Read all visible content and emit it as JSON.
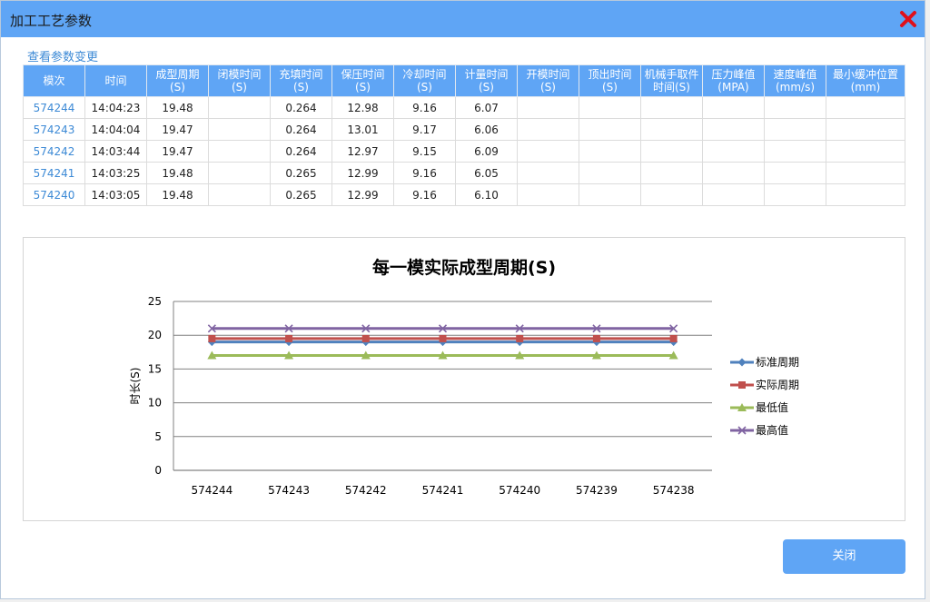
{
  "dialog": {
    "title": "加工工艺参数",
    "view_changes_link": "查看参数变更",
    "close_button": "关闭"
  },
  "table": {
    "headers": [
      "模次",
      "时间",
      "成型周期\n(S)",
      "闭模时间\n(S)",
      "充填时间\n(S)",
      "保压时间\n(S)",
      "冷却时间\n(S)",
      "计量时间\n(S)",
      "开模时间\n(S)",
      "顶出时间\n(S)",
      "机械手取件\n时间(S)",
      "压力峰值\n(MPA)",
      "速度峰值\n(mm/s)",
      "最小缓冲位置\n(mm)"
    ],
    "rows": [
      [
        "574244",
        "14:04:23",
        "19.48",
        "",
        "0.264",
        "12.98",
        "9.16",
        "6.07",
        "",
        "",
        "",
        "",
        "",
        ""
      ],
      [
        "574243",
        "14:04:04",
        "19.47",
        "",
        "0.264",
        "13.01",
        "9.17",
        "6.06",
        "",
        "",
        "",
        "",
        "",
        ""
      ],
      [
        "574242",
        "14:03:44",
        "19.47",
        "",
        "0.264",
        "12.97",
        "9.15",
        "6.09",
        "",
        "",
        "",
        "",
        "",
        ""
      ],
      [
        "574241",
        "14:03:25",
        "19.48",
        "",
        "0.265",
        "12.99",
        "9.16",
        "6.05",
        "",
        "",
        "",
        "",
        "",
        ""
      ],
      [
        "574240",
        "14:03:05",
        "19.48",
        "",
        "0.265",
        "12.99",
        "9.16",
        "6.10",
        "",
        "",
        "",
        "",
        "",
        ""
      ]
    ]
  },
  "chart_data": {
    "type": "line",
    "title": "每一模实际成型周期(S)",
    "ylabel": "时长(S)",
    "xlabel": "",
    "ylim": [
      0,
      25
    ],
    "yticks": [
      "0",
      "5",
      "10",
      "15",
      "20",
      "25"
    ],
    "grid": true,
    "legend": "right",
    "categories": [
      "574244",
      "574243",
      "574242",
      "574241",
      "574240",
      "574239",
      "574238"
    ],
    "series": [
      {
        "name": "标准周期",
        "color": "#4f81bd",
        "marker": "diamond",
        "values": [
          19,
          19,
          19,
          19,
          19,
          19,
          19
        ]
      },
      {
        "name": "实际周期",
        "color": "#c0504d",
        "marker": "square",
        "values": [
          19.5,
          19.5,
          19.5,
          19.5,
          19.5,
          19.5,
          19.5
        ]
      },
      {
        "name": "最低值",
        "color": "#9bbb59",
        "marker": "triangle",
        "values": [
          17,
          17,
          17,
          17,
          17,
          17,
          17
        ]
      },
      {
        "name": "最高值",
        "color": "#8064a2",
        "marker": "x",
        "values": [
          21,
          21,
          21,
          21,
          21,
          21,
          21
        ]
      }
    ]
  }
}
